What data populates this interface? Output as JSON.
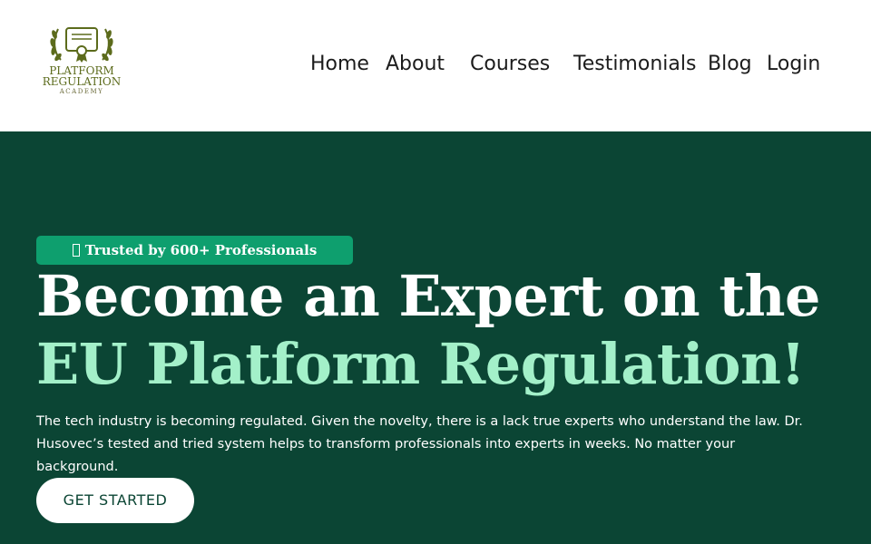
{
  "logo": {
    "line1": "PLATFORM",
    "line2": "REGULATION",
    "line3": "ACADEMY",
    "icon": "certificate-laurel-icon",
    "color": "#5c6b1c"
  },
  "nav": {
    "items": [
      {
        "label": "Home"
      },
      {
        "label": "About"
      },
      {
        "label": "Courses"
      },
      {
        "label": "Testimonials"
      },
      {
        "label": "Blog"
      },
      {
        "label": "Login"
      }
    ]
  },
  "hero": {
    "badge_icon": "missing-glyph-icon",
    "badge_text": "Trusted by 600+ Professionals",
    "title_line1": "Become an Expert on the",
    "title_line2": "EU Platform Regulation!",
    "description": "The tech industry is becoming regulated. Given the novelty, there is a lack true experts who understand the law. Dr. Husovec’s tested and tried system helps to transform professionals into experts in weeks. No matter your background.",
    "cta_label": "GET STARTED"
  },
  "colors": {
    "hero_background": "#0b4534",
    "badge_background": "#0e9f6e",
    "title_accent": "#a3f0c9",
    "logo_olive": "#5c6b1c"
  }
}
